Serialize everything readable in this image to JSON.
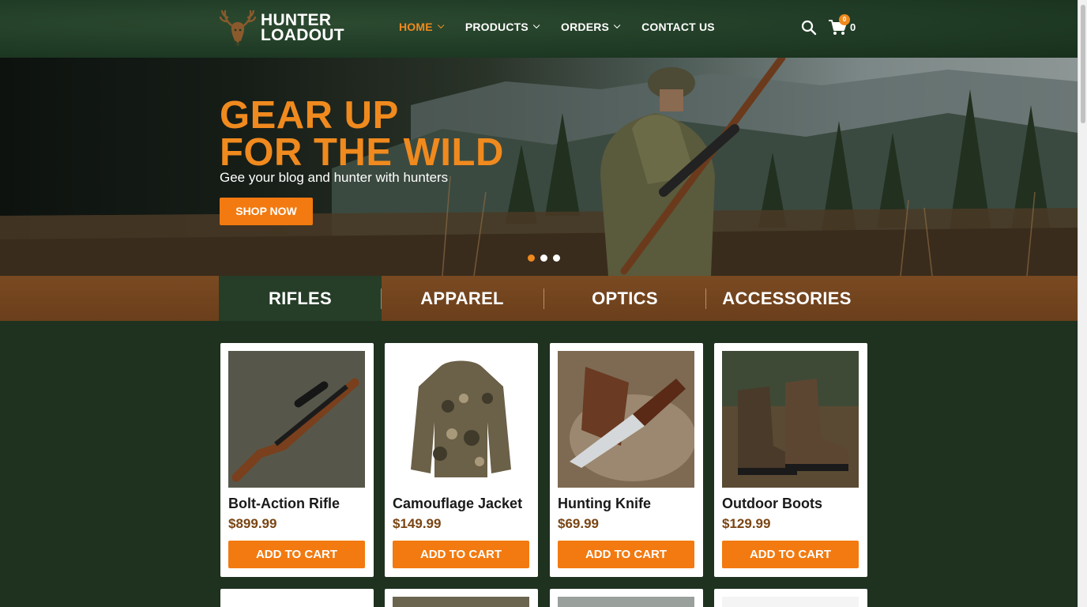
{
  "brand": {
    "line1": "HUNTER",
    "line2": "LOADOUT",
    "logo_icon": "deer-head-icon"
  },
  "nav": {
    "items": [
      {
        "label": "HOME",
        "active": true,
        "has_dropdown": true
      },
      {
        "label": "PRODUCTS",
        "active": false,
        "has_dropdown": true
      },
      {
        "label": "ORDERS",
        "active": false,
        "has_dropdown": true
      },
      {
        "label": "CONTACT US",
        "active": false,
        "has_dropdown": false
      }
    ]
  },
  "cart": {
    "badge": "0",
    "count": "0"
  },
  "hero": {
    "title_line1": "GEAR UP",
    "title_line2": "FOR THE WILD",
    "subtitle": "Gee your blog and hunter with hunters",
    "cta": "SHOP NOW",
    "slides": 3,
    "active_slide": 1
  },
  "categories": [
    {
      "label": "RIFLES",
      "active": true
    },
    {
      "label": "APPAREL",
      "active": false
    },
    {
      "label": "OPTICS",
      "active": false
    },
    {
      "label": "ACCESSORIES",
      "active": false
    }
  ],
  "products": [
    {
      "name": "Bolt-Action Rifle",
      "price": "$899.99",
      "button": "ADD TO CART",
      "image": "rifle"
    },
    {
      "name": "Camouflage Jacket",
      "price": "$149.99",
      "button": "ADD TO CART",
      "image": "jacket"
    },
    {
      "name": "Hunting Knife",
      "price": "$69.99",
      "button": "ADD TO CART",
      "image": "knife"
    },
    {
      "name": "Outdoor Boots",
      "price": "$129.99",
      "button": "ADD TO CART",
      "image": "boots"
    }
  ],
  "colors": {
    "accent": "#f08a1e",
    "button": "#f27a10",
    "dark_green": "#1e321f",
    "brown": "#6b3f1b",
    "price": "#7a4513"
  }
}
